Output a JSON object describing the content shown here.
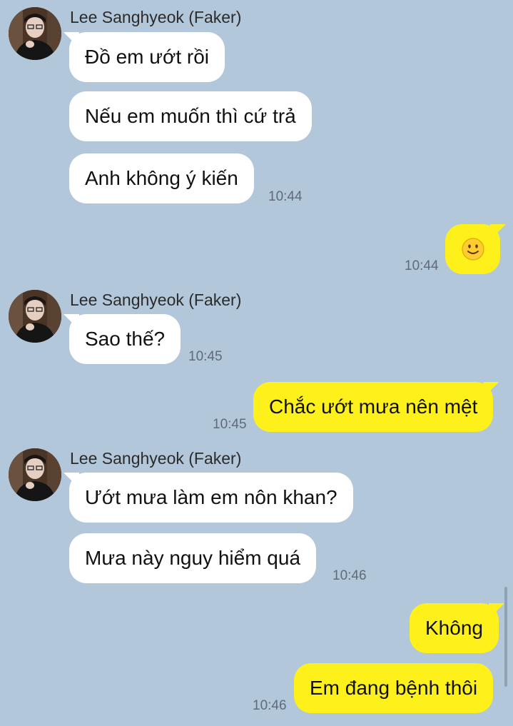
{
  "contact": {
    "name": "Lee Sanghyeok (Faker)"
  },
  "colors": {
    "background": "#b2c7da",
    "incoming_bubble": "#ffffff",
    "outgoing_bubble": "#fef01b",
    "timestamp": "#5f6b78"
  },
  "messages": [
    {
      "dir": "in",
      "text": "Đồ em ướt rồi"
    },
    {
      "dir": "in",
      "text": "Nếu em muốn thì cứ trả"
    },
    {
      "dir": "in",
      "text": "Anh không ý kiến",
      "time": "10:44"
    },
    {
      "dir": "out",
      "emoji": "slightly-smiling-face-icon",
      "time": "10:44"
    },
    {
      "dir": "in",
      "text": "Sao thế?",
      "time": "10:45"
    },
    {
      "dir": "out",
      "text": "Chắc ướt mưa nên mệt",
      "time": "10:45"
    },
    {
      "dir": "in",
      "text": "Ướt mưa làm em nôn khan?"
    },
    {
      "dir": "in",
      "text": "Mưa này nguy hiểm quá",
      "time": "10:46"
    },
    {
      "dir": "out",
      "text": "Không"
    },
    {
      "dir": "out",
      "text": "Em đang bệnh thôi",
      "time": "10:46"
    }
  ]
}
